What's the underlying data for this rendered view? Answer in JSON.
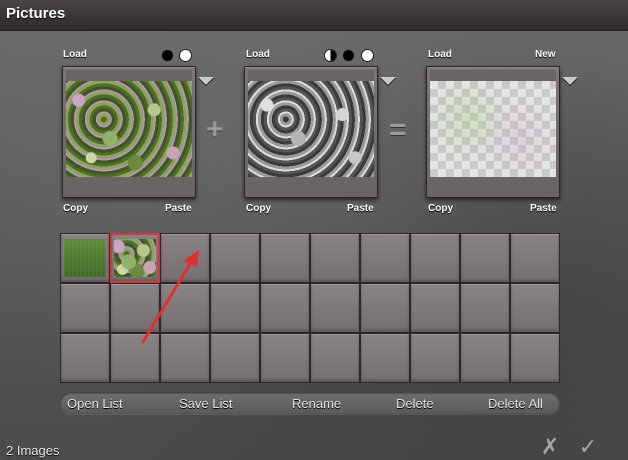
{
  "window": {
    "title": "Pictures"
  },
  "panels": [
    {
      "left_label": "Load",
      "right_label": "",
      "bottom_left": "Copy",
      "bottom_right": "Paste",
      "image": "foliage-color"
    },
    {
      "left_label": "Load",
      "right_label": "",
      "bottom_left": "Copy",
      "bottom_right": "Paste",
      "image": "foliage-grayscale"
    },
    {
      "left_label": "Load",
      "right_label": "New",
      "bottom_left": "Copy",
      "bottom_right": "Paste",
      "image": "transparency-checker"
    }
  ],
  "operators": {
    "plus": "+",
    "equals": "="
  },
  "channel_toggles": {
    "panel1": [
      "black",
      "white"
    ],
    "panel2": [
      "half",
      "black",
      "white"
    ]
  },
  "thumbnail_grid": {
    "rows": 3,
    "cols": 10,
    "filled": [
      "grass",
      "foliage-color"
    ],
    "selected_index": 1
  },
  "buttons": {
    "open_list": "Open List",
    "save_list": "Save List",
    "rename": "Rename",
    "delete": "Delete",
    "delete_all": "Delete All"
  },
  "status": {
    "count": "2 Images"
  },
  "actions": {
    "cancel": "✗",
    "confirm": "✓"
  },
  "colors": {
    "selection": "#d23a3a",
    "arrow": "#e0302a"
  }
}
